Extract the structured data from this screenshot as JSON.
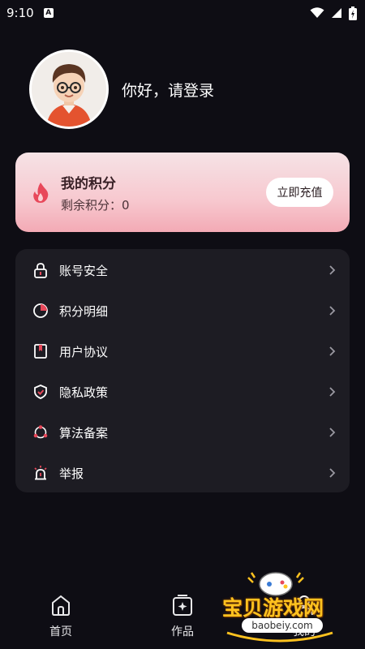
{
  "status_bar": {
    "time": "9:10",
    "notification_glyph": "A"
  },
  "profile": {
    "greeting": "你好，请登录",
    "avatar_icon": "cartoon-boy-avatar"
  },
  "points": {
    "title": "我的积分",
    "remaining": "剩余积分：0",
    "recharge_label": "立即充值",
    "icon": "fire-icon"
  },
  "menu": {
    "items": [
      {
        "label": "账号安全",
        "icon": "lock-icon"
      },
      {
        "label": "积分明细",
        "icon": "pie-chart-icon"
      },
      {
        "label": "用户协议",
        "icon": "bookmark-book-icon"
      },
      {
        "label": "隐私政策",
        "icon": "shield-check-icon"
      },
      {
        "label": "算法备案",
        "icon": "network-nodes-icon"
      },
      {
        "label": "举报",
        "icon": "alarm-siren-icon"
      }
    ]
  },
  "tabbar": {
    "tabs": [
      {
        "label": "首页",
        "icon": "home-icon"
      },
      {
        "label": "作品",
        "icon": "works-sparkle-icon"
      },
      {
        "label": "我的",
        "icon": "profile-icon"
      }
    ]
  },
  "watermark": {
    "text": "宝贝游戏网",
    "url": "baobeiy.com"
  },
  "colors": {
    "background": "#0e0d14",
    "menu_background": "#1d1c23",
    "card_gradient_top": "#f6e3e6",
    "card_gradient_bottom": "#f3aab5",
    "accent_red": "#e8485a"
  }
}
